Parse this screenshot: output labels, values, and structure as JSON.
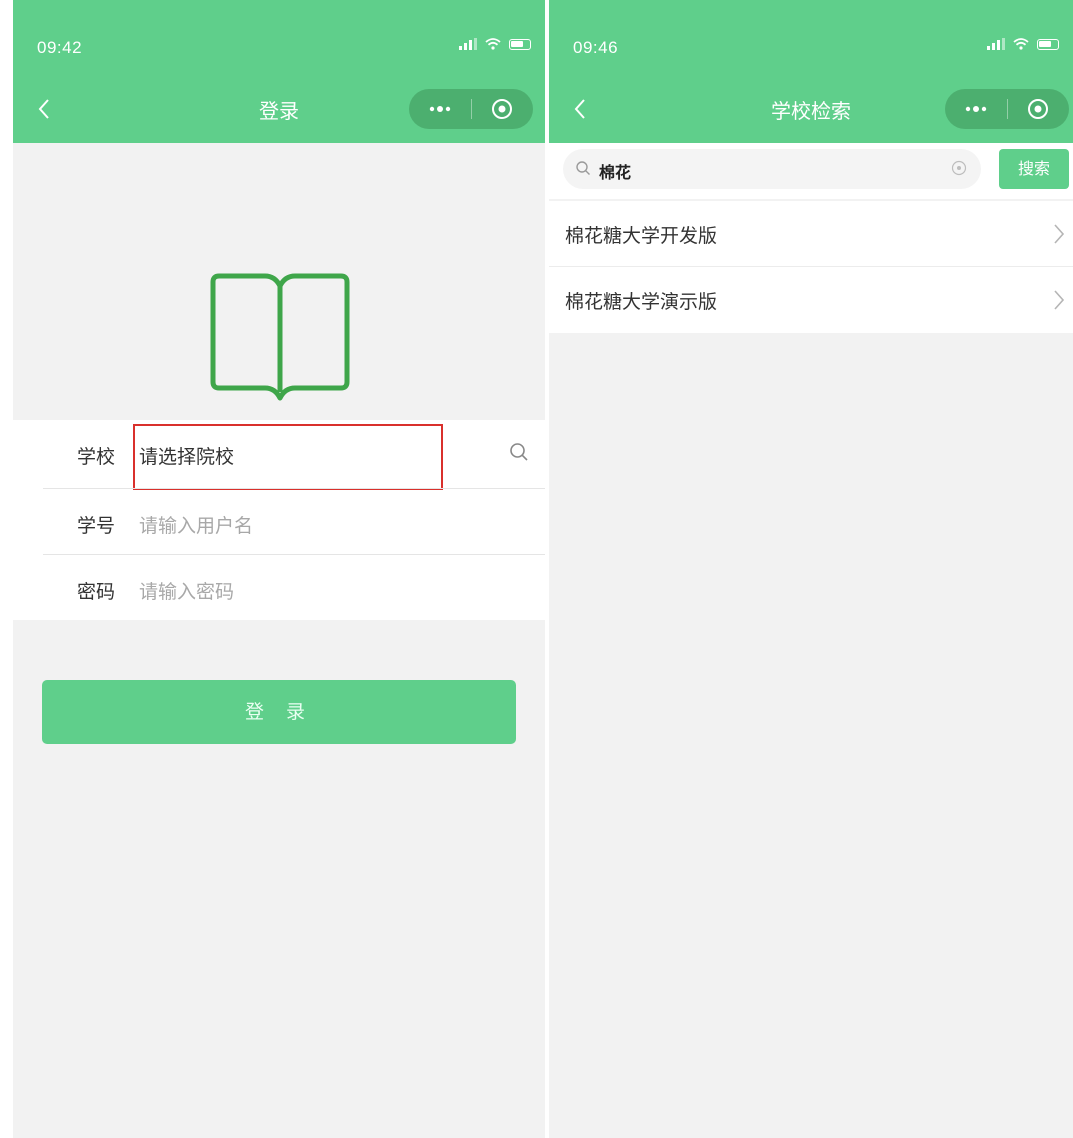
{
  "login_screen": {
    "status": {
      "time": "09:42"
    },
    "navbar": {
      "title": "登录"
    },
    "form": {
      "school": {
        "label": "学校",
        "value": "请选择院校"
      },
      "student_id": {
        "label": "学号",
        "placeholder": "请输入用户名"
      },
      "password": {
        "label": "密码",
        "placeholder": "请输入密码"
      }
    },
    "login_button": "登 录"
  },
  "search_screen": {
    "status": {
      "time": "09:46"
    },
    "navbar": {
      "title": "学校检索"
    },
    "search": {
      "query": "棉花",
      "button": "搜索"
    },
    "results": [
      {
        "label": "棉花糖大学开发版"
      },
      {
        "label": "棉花糖大学演示版"
      }
    ]
  },
  "colors": {
    "brand_green": "#5fcf8b",
    "highlight_red": "#d9302c"
  },
  "icons": [
    "back-arrow-icon",
    "more-dots-icon",
    "target-close-icon",
    "book-icon",
    "search-icon",
    "clear-icon",
    "chevron-right-icon",
    "signal-icon",
    "wifi-icon",
    "battery-icon"
  ]
}
